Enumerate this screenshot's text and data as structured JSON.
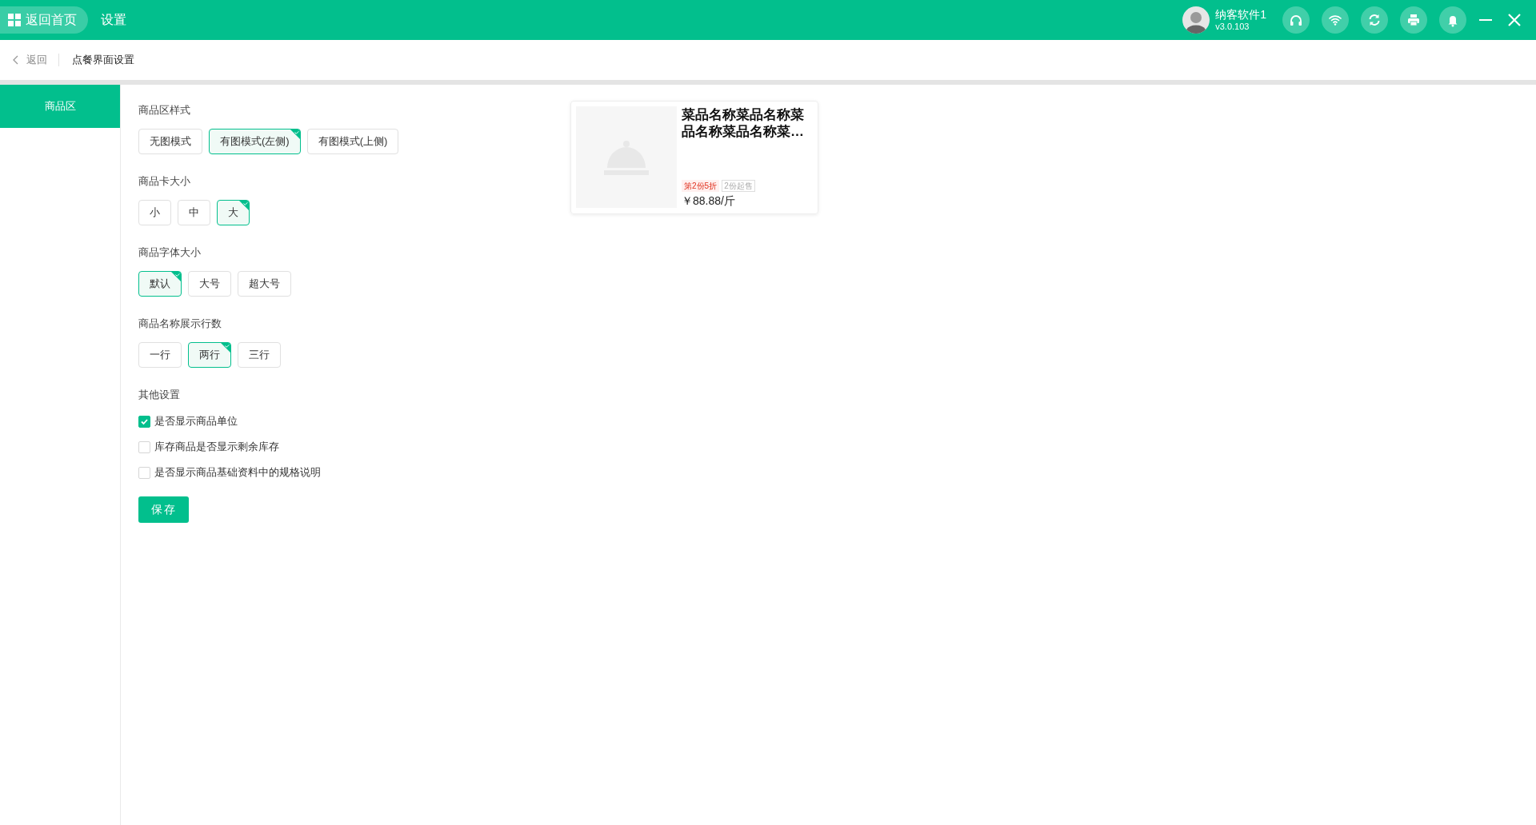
{
  "top_bar": {
    "home_button": "返回首页",
    "title": "设置",
    "user": {
      "name": "纳客软件1",
      "version": "v3.0.103"
    }
  },
  "breadcrumb": {
    "back": "返回",
    "title": "点餐界面设置"
  },
  "sidebar": {
    "items": [
      {
        "label": "商品区",
        "selected": true
      }
    ]
  },
  "settings": {
    "groups": [
      {
        "label": "商品区样式",
        "options": [
          {
            "label": "无图模式",
            "selected": false
          },
          {
            "label": "有图模式(左侧)",
            "selected": true
          },
          {
            "label": "有图模式(上侧)",
            "selected": false
          }
        ]
      },
      {
        "label": "商品卡大小",
        "options": [
          {
            "label": "小",
            "selected": false
          },
          {
            "label": "中",
            "selected": false
          },
          {
            "label": "大",
            "selected": true
          }
        ]
      },
      {
        "label": "商品字体大小",
        "options": [
          {
            "label": "默认",
            "selected": true
          },
          {
            "label": "大号",
            "selected": false
          },
          {
            "label": "超大号",
            "selected": false
          }
        ]
      },
      {
        "label": "商品名称展示行数",
        "options": [
          {
            "label": "一行",
            "selected": false
          },
          {
            "label": "两行",
            "selected": true
          },
          {
            "label": "三行",
            "selected": false
          }
        ]
      }
    ],
    "other": {
      "label": "其他设置",
      "checkboxes": [
        {
          "label": "是否显示商品单位",
          "checked": true
        },
        {
          "label": "库存商品是否显示剩余库存",
          "checked": false
        },
        {
          "label": "是否显示商品基础资料中的规格说明",
          "checked": false
        }
      ]
    },
    "save_button": "保存"
  },
  "preview": {
    "name_lines": [
      "菜品名称菜品名称菜",
      "品名称菜品名称菜…"
    ],
    "tags": [
      {
        "text": "第2份5折",
        "kind": "promo"
      },
      {
        "text": "2份起售",
        "kind": "minimum"
      }
    ],
    "price": "￥88.88/斤"
  }
}
